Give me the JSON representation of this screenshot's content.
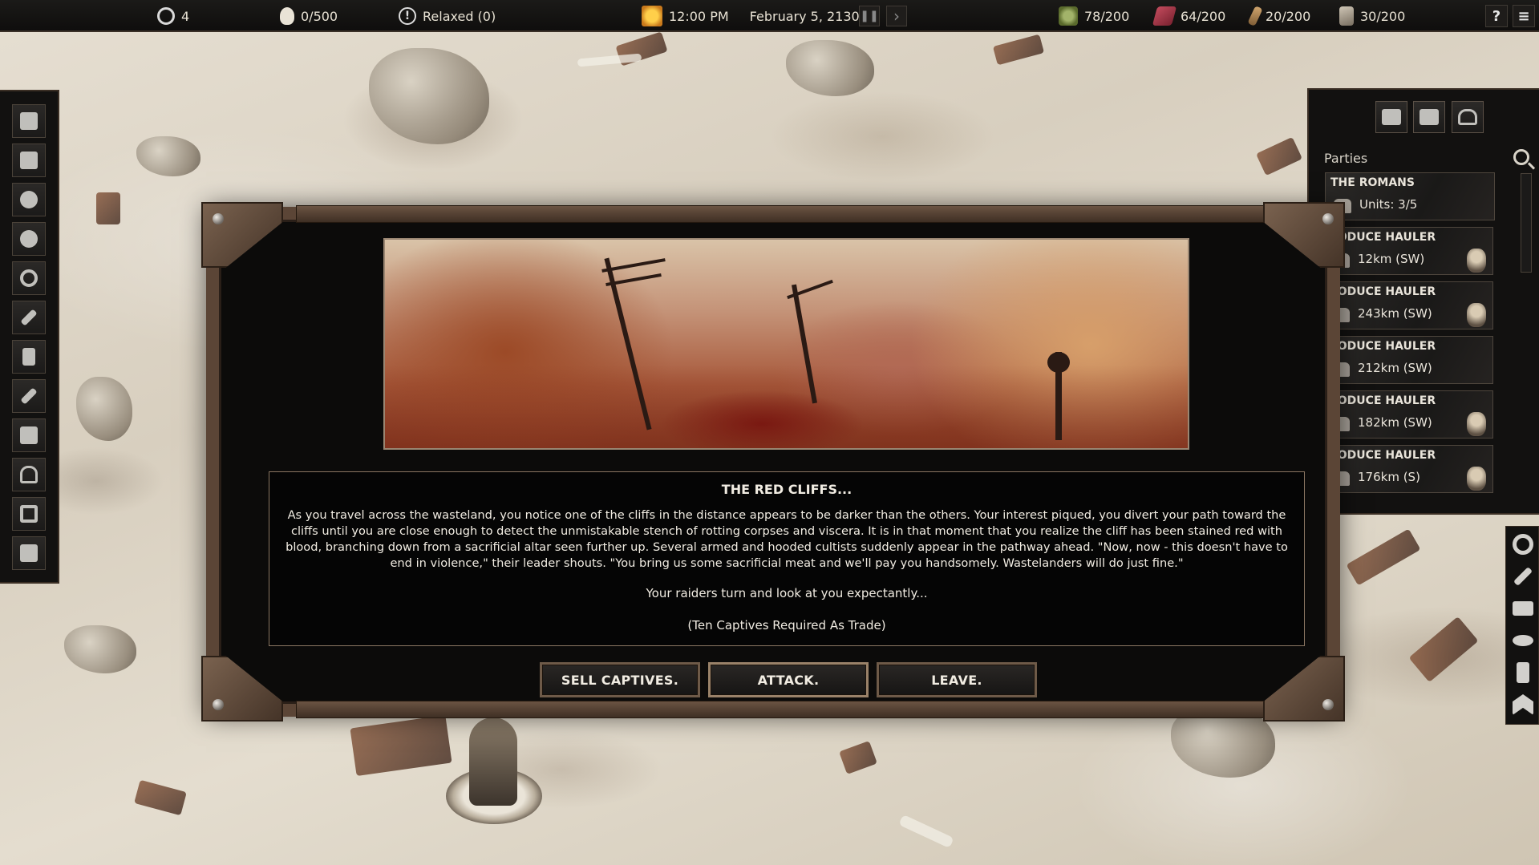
{
  "topbar": {
    "stats": [
      {
        "icon": "gear-icon",
        "value": "4"
      },
      {
        "icon": "skull-icon",
        "value": "0/500"
      },
      {
        "icon": "alert-icon",
        "value": "Relaxed (0)"
      }
    ],
    "time": "12:00 PM",
    "date": "February 5, 2130",
    "pause_icon": "❚❚",
    "play_icon": "›",
    "resources": [
      {
        "icon": "food-icon",
        "value": "78/200"
      },
      {
        "icon": "meat-icon",
        "value": "64/200"
      },
      {
        "icon": "drink-icon",
        "value": "20/200"
      },
      {
        "icon": "boot-icon",
        "value": "30/200"
      }
    ],
    "help_label": "?",
    "menu_label": "≡"
  },
  "left_sidebar": {
    "buttons": [
      "people-icon",
      "camel-icon",
      "skull-icon",
      "wheel-icon",
      "gear-icon",
      "hammer-icon",
      "character-icon",
      "ruler-icon",
      "list-icon",
      "home-icon",
      "frame-icon",
      "panel-icon"
    ]
  },
  "parties_panel": {
    "tabs": [
      "camel-icon",
      "people-icon",
      "home-icon"
    ],
    "title": "Parties",
    "parties": [
      {
        "name": "THE ROMANS",
        "info": "Units: 3/5"
      },
      {
        "name": "RODUCE HAULER",
        "info": "12km (SW)"
      },
      {
        "name": "RODUCE HAULER",
        "info": "243km (SW)"
      },
      {
        "name": "RODUCE HAULER",
        "info": "212km (SW)"
      },
      {
        "name": "RODUCE HAULER",
        "info": "182km (SW)"
      },
      {
        "name": "RODUCE HAULER",
        "info": "176km (S)"
      }
    ]
  },
  "action_column": {
    "buttons": [
      "wheel-icon",
      "hammer-icon",
      "fence-icon",
      "eye-icon",
      "leg-icon",
      "rank-icon"
    ]
  },
  "event": {
    "title": "THE RED CLIFFS...",
    "body": "As you travel across the wasteland, you notice one of the cliffs in the distance appears to be darker than the others. Your interest piqued, you divert your path toward the cliffs until you are close enough to detect the unmistakable stench of rotting corpses and viscera. It is in that moment that you realize the cliff has been stained red with blood, branching down from a sacrificial altar seen further up. Several armed and hooded cultists suddenly appear in the pathway ahead. \"Now, now - this doesn't have to end in violence,\" their leader shouts. \"You bring us some sacrificial meat and we'll pay you handsomely. Wastelanders will do just fine.\"",
    "line2": "Your raiders turn and look at you expectantly...",
    "line3": "(Ten Captives Required As Trade)",
    "choices": [
      "SELL CAPTIVES.",
      "ATTACK.",
      "LEAVE."
    ]
  }
}
